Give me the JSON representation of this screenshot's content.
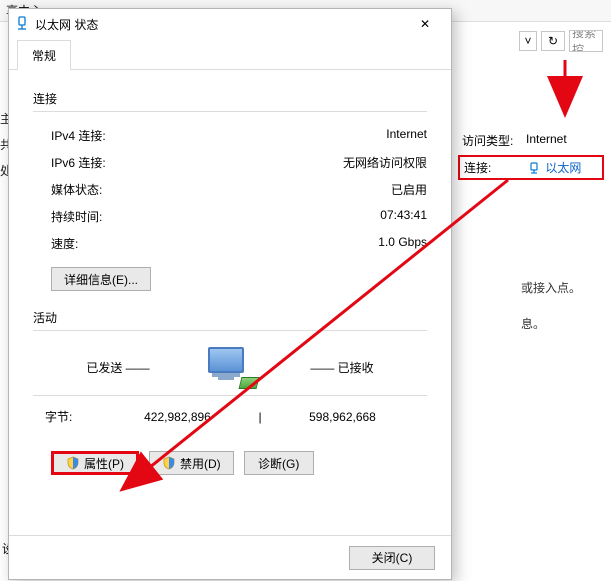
{
  "background": {
    "breadcrumb_frag": "享中心",
    "side_chars": [
      "主",
      "共",
      "处"
    ],
    "dropdown_glyph": "˅",
    "refresh_glyph": "↻",
    "search_placeholder": "搜索控",
    "right_pane": {
      "access_type_label": "访问类型:",
      "access_type_value": "Internet",
      "conn_label": "连接:",
      "conn_link_text": "以太网"
    },
    "info_frag1": "或接入点。",
    "info_frag2": "息。",
    "bottom_frag": "设"
  },
  "dialog": {
    "title": "以太网 状态",
    "close_glyph": "✕",
    "tab_general": "常规",
    "conn_section": "连接",
    "rows": {
      "ipv4_label": "IPv4 连接:",
      "ipv4_value": "Internet",
      "ipv6_label": "IPv6 连接:",
      "ipv6_value": "无网络访问权限",
      "media_label": "媒体状态:",
      "media_value": "已启用",
      "duration_label": "持续时间:",
      "duration_value": "07:43:41",
      "speed_label": "速度:",
      "speed_value": "1.0 Gbps"
    },
    "details_btn": "详细信息(E)...",
    "activity_section": "活动",
    "sent_label": "已发送",
    "recv_label": "已接收",
    "bytes_label": "字节:",
    "bytes_sent": "422,982,896",
    "bytes_sep": "|",
    "bytes_recv": "598,962,668",
    "properties_btn": "属性(P)",
    "disable_btn": "禁用(D)",
    "diagnose_btn": "诊断(G)",
    "close_btn": "关闭(C)"
  }
}
